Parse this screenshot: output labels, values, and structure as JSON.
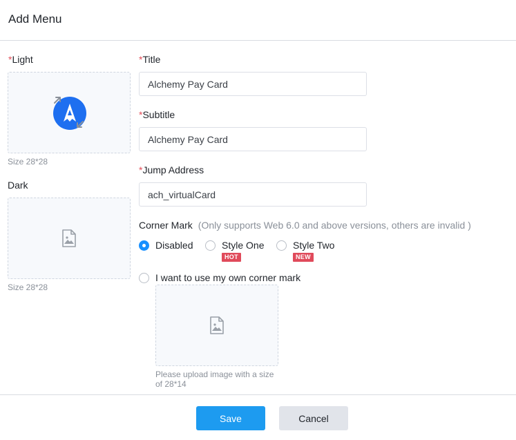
{
  "dialog": {
    "title": "Add Menu"
  },
  "required_mark": "*",
  "light": {
    "label": "Light",
    "size_hint": "Size 28*28"
  },
  "dark": {
    "label": "Dark",
    "size_hint": "Size 28*28"
  },
  "form": {
    "title": {
      "label": "Title",
      "value": "Alchemy Pay Card"
    },
    "subtitle": {
      "label": "Subtitle",
      "value": "Alchemy Pay Card"
    },
    "jump_address": {
      "label": "Jump Address",
      "value": "ach_virtualCard"
    }
  },
  "corner_mark": {
    "label": "Corner Mark",
    "hint": "(Only supports Web 6.0 and above versions, others are invalid )",
    "options": [
      {
        "label": "Disabled",
        "checked": true
      },
      {
        "label": "Style One",
        "badge": "HOT",
        "checked": false
      },
      {
        "label": "Style Two",
        "badge": "NEW",
        "checked": false
      }
    ],
    "own": {
      "label": "I want to use my own corner mark",
      "checked": false,
      "upload_hint": "Please upload image with a size of 28*14"
    }
  },
  "footer": {
    "save_label": "Save",
    "cancel_label": "Cancel"
  },
  "colors": {
    "primary": "#1d9bf0",
    "required": "#e34d59",
    "badge": "#e04a5b",
    "light_icon": "#1e6ff0"
  }
}
